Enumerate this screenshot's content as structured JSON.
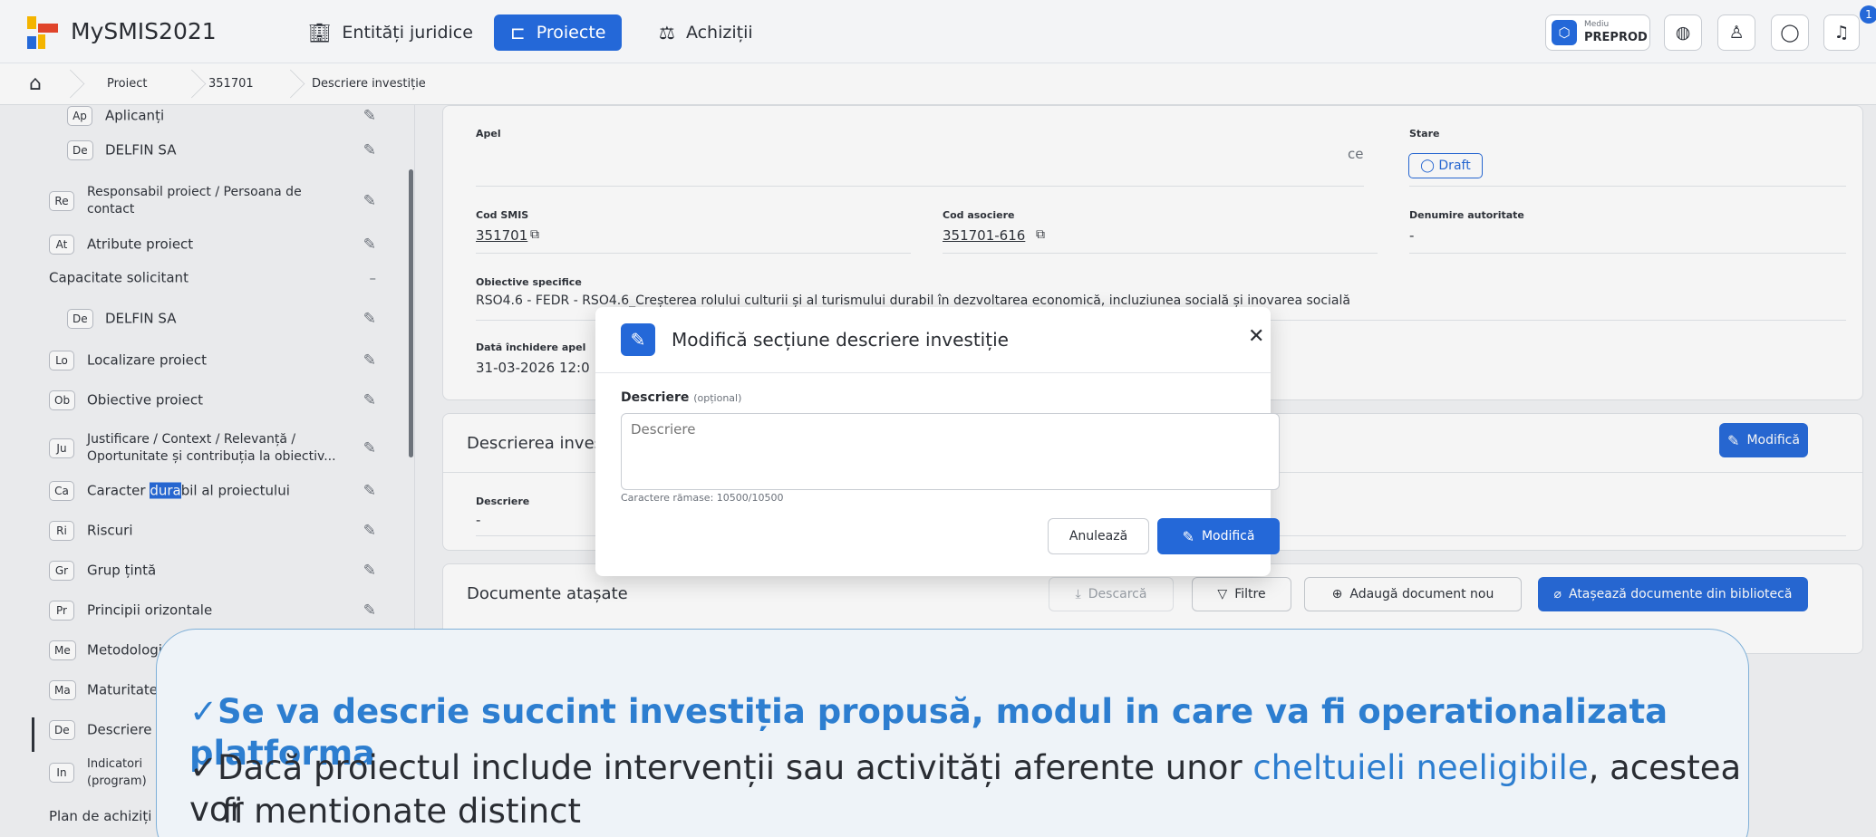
{
  "header": {
    "app_title": "MySMIS2021",
    "nav": [
      {
        "label": "Entități juridice",
        "icon": "building-icon"
      },
      {
        "label": "Proiecte",
        "icon": "tree-icon"
      },
      {
        "label": "Achiziții",
        "icon": "scale-icon"
      }
    ],
    "mediu_small": "Mediu",
    "mediu_value": "PREPROD",
    "notif_count": "1",
    "colors": {
      "accent": "#2468d8",
      "background": "#f3f4f6"
    }
  },
  "breadcrumb": [
    "Proiect",
    "351701",
    "Descriere investiție"
  ],
  "sidebar": {
    "items": [
      {
        "badge": "Ap",
        "label": "Aplicanți"
      },
      {
        "badge": "De",
        "label": "DELFIN SA"
      },
      {
        "badge": "Re",
        "label1": "Responsabil proiect / Persoana de",
        "label2": "contact"
      },
      {
        "badge": "At",
        "label": "Atribute proiect"
      },
      {
        "badge": "De",
        "label": "DELFIN SA"
      },
      {
        "badge": "Lo",
        "label": "Localizare proiect"
      },
      {
        "badge": "Ob",
        "label": "Obiective proiect"
      },
      {
        "badge": "Ju",
        "label1": "Justificare / Context / Relevanță /",
        "label2": "Oportunitate și contribuția la obiectiv..."
      },
      {
        "badge": "Ca",
        "label_pre": "Caracter ",
        "label_hl": "dura",
        "label_post": "bil al proiectului"
      },
      {
        "badge": "Ri",
        "label": "Riscuri"
      },
      {
        "badge": "Gr",
        "label": "Grup țintă"
      },
      {
        "badge": "Pr",
        "label": "Principii orizontale"
      },
      {
        "badge": "Me",
        "label": "Metodologi"
      },
      {
        "badge": "Ma",
        "label": "Maturitate"
      },
      {
        "badge": "De",
        "label": "Descriere"
      },
      {
        "badge": "In",
        "label1": "Indicatori",
        "label2": "(program)"
      }
    ],
    "group_capacitate": "Capacitate solicitant",
    "group_capacitate_mark": "–",
    "group_plan": "Plan de achiziți"
  },
  "details": {
    "apel_label": "Apel",
    "apel_trunc": "ce",
    "stare_label": "Stare",
    "stare_value": "Draft",
    "cod_smis_label": "Cod SMIS",
    "cod_smis_value": "351701",
    "cod_asociere_label": "Cod asociere",
    "cod_asociere_value": "351701-616",
    "autoritate_label": "Denumire autoritate",
    "autoritate_value": "-",
    "obiective_label": "Obiective specifice",
    "obiective_value": "RSO4.6 - FEDR - RSO4.6_Creșterea rolului culturii și al turismului durabil în dezvoltarea economică, incluziunea socială și inovarea socială",
    "data_label": "Dată închidere apel",
    "data_value": "31-03-2026 12:0"
  },
  "descriere_card": {
    "title": "Descrierea inves",
    "modify_label": "Modifică",
    "desc_label": "Descriere",
    "desc_value": "-"
  },
  "documente": {
    "title": "Documente atașate",
    "descarca": "Descarcă",
    "filtre": "Filtre",
    "adauga": "Adaugă document nou",
    "ataseaza": "Atașează documente din bibliotecă"
  },
  "modal": {
    "title": "Modifică secțiune descriere investiție",
    "field_label": "Descriere",
    "field_optional": "(opțional)",
    "placeholder": "Descriere",
    "counter": "Caractere rămase: 10500/10500",
    "cancel": "Anulează",
    "submit": "Modifică"
  },
  "callout": {
    "check": "✓",
    "line1": "Se va descrie  succint investiția propusă, modul in care va fi operationalizata platforma",
    "line2_pre": "Dacă proiectul include intervenții sau activități aferente unor ",
    "line2_link": "cheltuieli neeligibile",
    "line2_post": ", acestea vor",
    "line3": "fi mentionate distinct"
  }
}
